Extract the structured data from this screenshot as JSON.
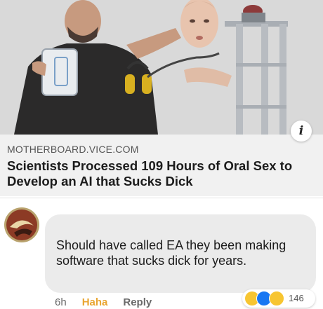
{
  "post": {
    "domain": "MOTHERBOARD.VICE.COM",
    "headline": "Scientists Processed 109 Hours of Oral Sex to Develop an AI that Sucks Dick",
    "info_glyph": "i"
  },
  "comment": {
    "text": "Should have called EA they been making software that sucks dick for years.",
    "time": "6h",
    "react_label": "Haha",
    "reply_label": "Reply",
    "reaction_count": "146",
    "reaction_icons": [
      "haha-reaction-icon",
      "like-reaction-icon",
      "wow-reaction-icon"
    ]
  },
  "colors": {
    "like_blue": "#1977f2",
    "emoji_yellow": "#f7c531"
  }
}
